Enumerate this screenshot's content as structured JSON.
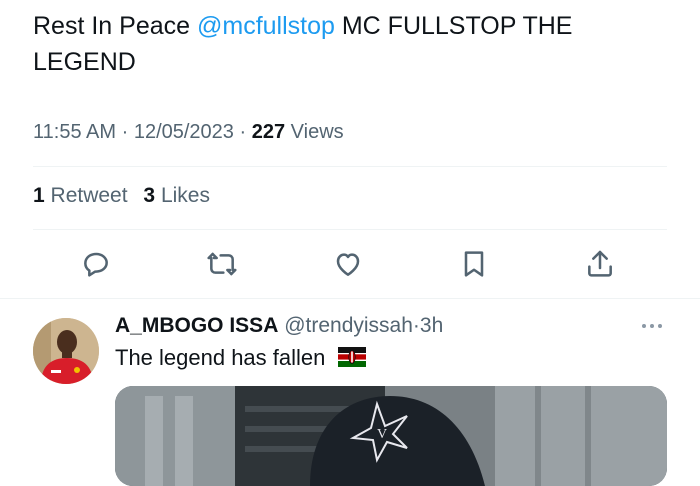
{
  "tweet": {
    "text_prefix": "Rest In Peace ",
    "mention": "@mcfullstop",
    "text_suffix": " MC FULLSTOP THE LEGEND",
    "time": "11:55 AM",
    "date": "12/05/2023",
    "views_count": "227",
    "views_label": "Views",
    "retweets_count": "1",
    "retweets_label": "Retweet",
    "likes_count": "3",
    "likes_label": "Likes"
  },
  "actions": {
    "icons": [
      "reply-icon",
      "retweet-icon",
      "like-icon",
      "bookmark-icon",
      "share-icon"
    ]
  },
  "reply": {
    "name": "A_MBOGO ISSA",
    "handle": "@trendyissah",
    "separator": "·",
    "time": "3h",
    "text": "The  legend has fallen",
    "flag": "Kenya"
  },
  "colors": {
    "link": "#1d9bf0",
    "secondary_text": "#536471",
    "primary_text": "#0f1419",
    "divider": "#eff3f4"
  }
}
